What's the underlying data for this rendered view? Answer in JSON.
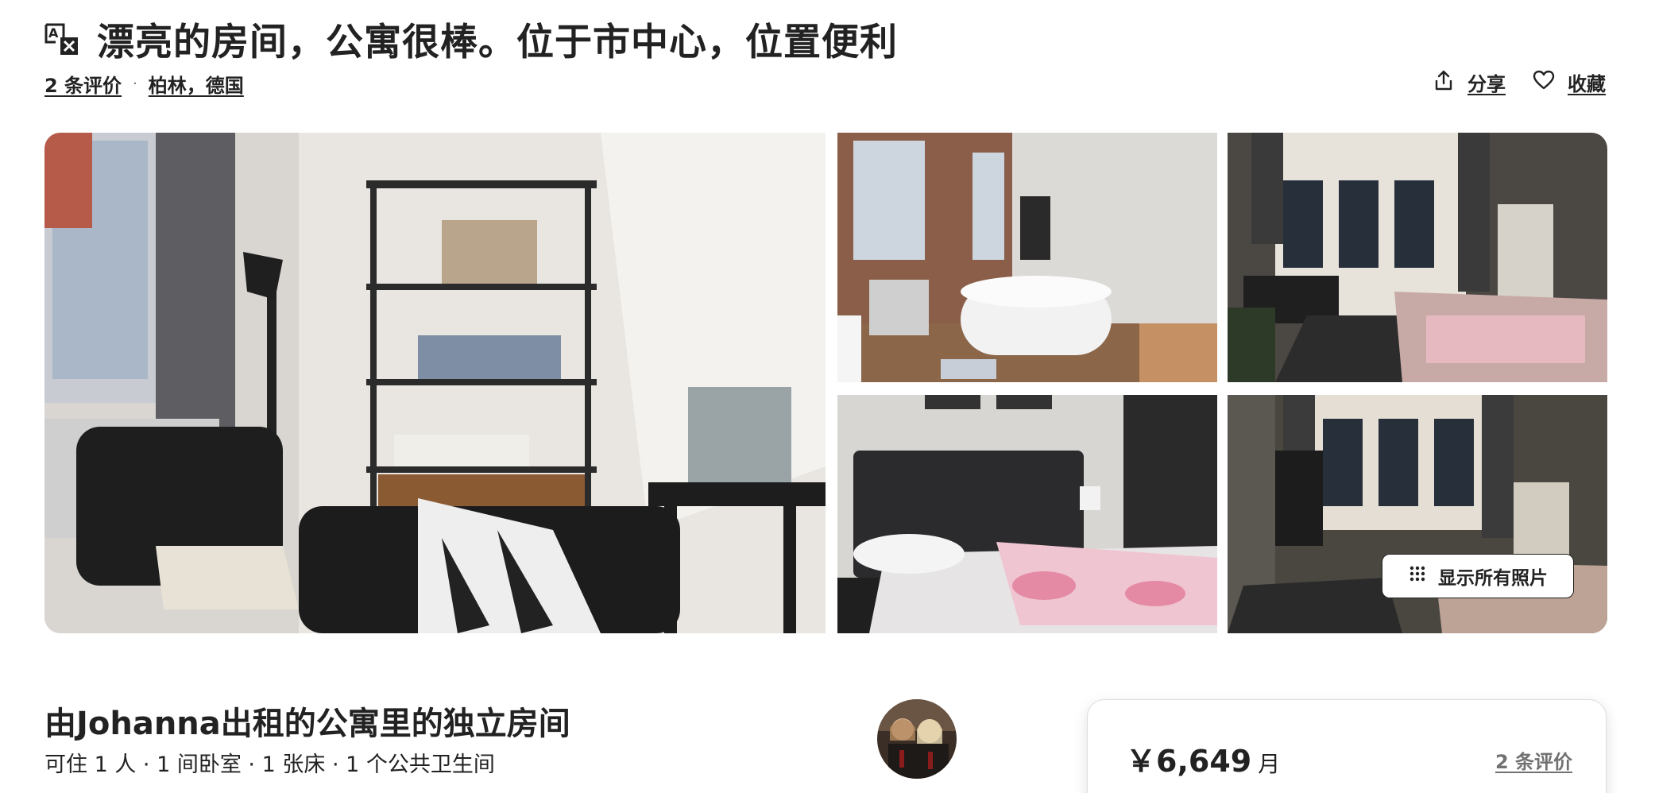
{
  "header": {
    "title": "漂亮的房间，公寓很棒。位于市中心，位置便利",
    "translate_icon": "translate-icon"
  },
  "meta": {
    "reviews": "2 条评价",
    "separator": "·",
    "location": "柏林，德国"
  },
  "actions": {
    "share_label": "分享",
    "share_icon": "share-icon",
    "save_label": "收藏",
    "save_icon": "heart-icon"
  },
  "gallery": {
    "show_all_label": "显示所有照片",
    "show_all_icon": "grid-dots-icon"
  },
  "listing": {
    "title": "由Johanna出租的公寓里的独立房间",
    "subtitle": "可住 1 人 · 1 间卧室 · 1 张床 · 1 个公共卫生间"
  },
  "price_card": {
    "amount": "￥6,649",
    "unit": "月",
    "reviews_link": "2 条评价"
  },
  "colors": {
    "text": "#222222",
    "muted": "#717171",
    "border": "#dddddd"
  }
}
